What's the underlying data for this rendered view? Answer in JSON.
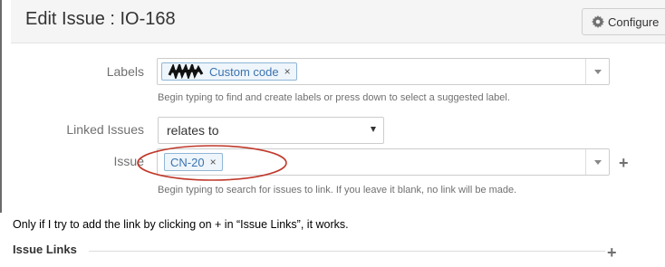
{
  "dialog": {
    "title": "Edit Issue : IO-168",
    "configure_label": "Configure"
  },
  "labels_field": {
    "label": "Labels",
    "tokens": [
      {
        "text": "Custom  code",
        "remove": "×"
      }
    ],
    "help": "Begin typing to find and create labels or press down to select a suggested label."
  },
  "linked_issues_field": {
    "label": "Linked Issues",
    "selected": "relates to"
  },
  "issue_field": {
    "label": "Issue",
    "tokens": [
      {
        "text": "CN-20",
        "remove": "×"
      }
    ],
    "help": "Begin typing to search for issues to link. If you leave it blank, no link will be made.",
    "add_label": "+"
  },
  "annotation": {
    "ellipse_color": "#c0392b"
  },
  "note": "Only if I try to add the link by clicking on + in “Issue Links”, it works.",
  "issue_links_section": {
    "title": "Issue Links",
    "add_label": "+"
  }
}
